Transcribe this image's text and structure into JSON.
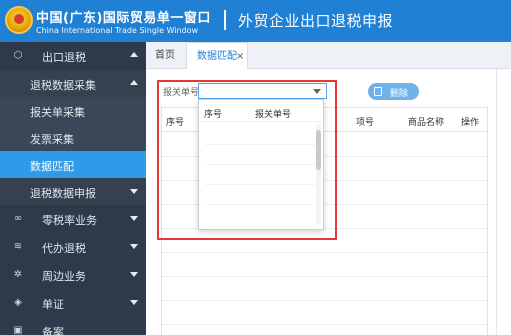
{
  "header": {
    "brand_cn": "中国(广东)国际贸易单一窗口",
    "brand_en": "China International Trade Single Window",
    "system_title": "外贸企业出口退税申报"
  },
  "sidebar": {
    "main_menu": "出口退税",
    "group": "退税数据采集",
    "items": [
      "报关单采集",
      "发票采集",
      "数据匹配"
    ],
    "active_item": "数据匹配",
    "declaration_group": "退税数据申报",
    "other_menus": [
      "零税率业务",
      "代办退税",
      "周边业务",
      "单证",
      "备案"
    ]
  },
  "tabs": {
    "home": "首页",
    "current": "数据匹配",
    "close_glyph": "×"
  },
  "form": {
    "customs_label": "报关单号",
    "selected_value": ""
  },
  "toolbar": {
    "delete_label": "删除"
  },
  "grid": {
    "columns": [
      "序号",
      "项号",
      "商品名称",
      "操作"
    ],
    "rows": []
  },
  "dropdown": {
    "columns": [
      "序号",
      "报关单号"
    ],
    "items": []
  },
  "colors": {
    "header": "#1f80d4",
    "sidebar": "#2d3a4b",
    "active": "#2f9be8",
    "highlight": "#e53935"
  }
}
